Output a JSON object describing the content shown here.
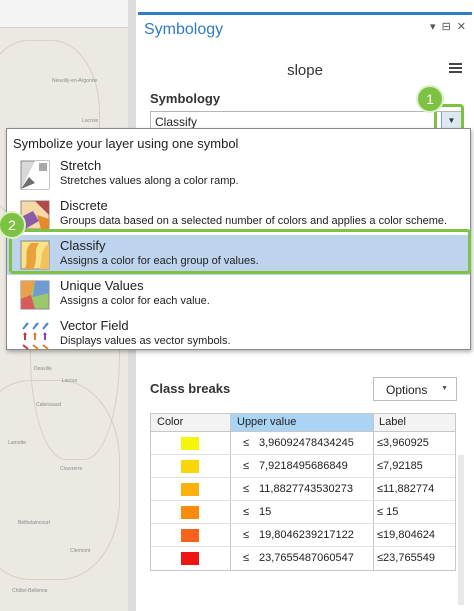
{
  "map": {
    "labels": [
      "Neuvilly-en-Argonne",
      "Lacroix",
      "Deuville",
      "Lacour",
      "Lamotte",
      "Cabessaud",
      "Couvrerre",
      "Béthelaincourt",
      "Clermont",
      "Châtel-Bellenne"
    ]
  },
  "panel": {
    "title": "Symbology",
    "controls": [
      "▾",
      "⊟",
      "✕"
    ],
    "layer_name": "slope",
    "symbology_label": "Symbology",
    "dropdown_value": "Classify",
    "dropdown_arrow": "▼"
  },
  "callouts": {
    "badge1": "1",
    "badge2": "2",
    "color": "#7dc242"
  },
  "popup": {
    "header": "Symbolize your layer using one symbol",
    "options": [
      {
        "title": "Stretch",
        "desc": "Stretches values along a color ramp.",
        "icon": "stretch-icon",
        "selected": false
      },
      {
        "title": "Discrete",
        "desc": "Groups data based on a selected number of colors and applies a color scheme.",
        "icon": "discrete-icon",
        "selected": false
      },
      {
        "title": "Classify",
        "desc": "Assigns a color for each group of values.",
        "icon": "classify-icon",
        "selected": true
      },
      {
        "title": "Unique Values",
        "desc": "Assigns a color for each value.",
        "icon": "unique-values-icon",
        "selected": false
      },
      {
        "title": "Vector Field",
        "desc": "Displays values as vector symbols.",
        "icon": "vector-field-icon",
        "selected": false
      }
    ]
  },
  "class_breaks": {
    "title": "Class breaks",
    "options_label": "Options",
    "columns": [
      "Color",
      "Upper value",
      "Label"
    ],
    "rows": [
      {
        "color": "#f5f50a",
        "le": "≤",
        "upper": "3,96092478434245",
        "label": "≤3,960925"
      },
      {
        "color": "#f9d50a",
        "le": "≤",
        "upper": "7,9218495686849",
        "label": "≤7,92185"
      },
      {
        "color": "#fbb10b",
        "le": "≤",
        "upper": "11,8827743530273",
        "label": "≤11,882774"
      },
      {
        "color": "#fc8a0c",
        "le": "≤",
        "upper": "15",
        "label": "≤ 15"
      },
      {
        "color": "#f9621a",
        "le": "≤",
        "upper": "19,8046239217122",
        "label": "≤19,804624"
      },
      {
        "color": "#ef1313",
        "le": "≤",
        "upper": "23,7655487060547",
        "label": "≤23,765549"
      }
    ]
  },
  "colors": {
    "accent": "#2d7cc4",
    "selection": "#bed3ec",
    "header_selected": "#a9d4f3"
  }
}
